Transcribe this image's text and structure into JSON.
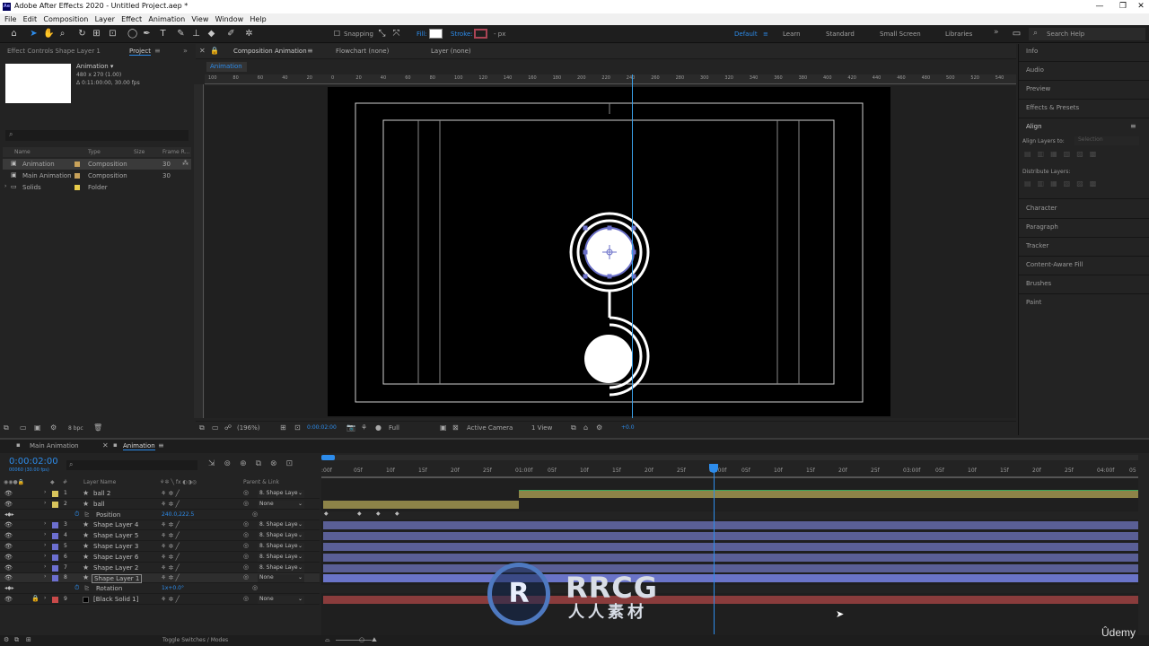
{
  "window": {
    "title": "Adobe After Effects 2020 - Untitled Project.aep *",
    "app_icon": "Ae",
    "buttons": [
      "minimize-icon",
      "restore-icon",
      "close-icon"
    ]
  },
  "menu": [
    "File",
    "Edit",
    "Composition",
    "Layer",
    "Effect",
    "Animation",
    "View",
    "Window",
    "Help"
  ],
  "toolbar": {
    "snapping_label": "Snapping",
    "fill_label": "Fill:",
    "stroke_label": "Stroke:",
    "stroke_units": "- px",
    "workspaces": [
      "Default",
      "Learn",
      "Standard",
      "Small Screen",
      "Libraries"
    ],
    "active_workspace": "Default",
    "search_placeholder": "Search Help"
  },
  "project_panel": {
    "tab_effect_controls": "Effect Controls Shape Layer 1",
    "tab_project": "Project",
    "comp_name": "Animation ▾",
    "comp_info1": "480 x 270 (1.00)",
    "comp_info2": "Δ 0:11:00:00, 30.00 fps",
    "columns": [
      "Name",
      "Type",
      "Size",
      "Frame R..."
    ],
    "items": [
      {
        "name": "Animation",
        "type": "Composition",
        "fps": "30",
        "color": "#c8a25a",
        "selected": true
      },
      {
        "name": "Main Animation",
        "type": "Composition",
        "fps": "30",
        "color": "#c8a25a",
        "selected": false
      },
      {
        "name": "Solids",
        "type": "Folder",
        "fps": "",
        "color": "#e8cc4a",
        "selected": false
      }
    ],
    "bpc": "8 bpc"
  },
  "comp_panel": {
    "tab_comp": "Composition Animation",
    "tab_flowchart": "Flowchart (none)",
    "tab_layer": "Layer (none)",
    "breadcrumb": "Animation",
    "ruler_ticks": [
      "100",
      "80",
      "60",
      "40",
      "20",
      "0",
      "20",
      "40",
      "60",
      "80",
      "100",
      "120",
      "140",
      "160",
      "180",
      "200",
      "220",
      "240",
      "260",
      "280",
      "300",
      "320",
      "340",
      "360",
      "380",
      "400",
      "420",
      "440",
      "460",
      "480",
      "500",
      "520",
      "540"
    ],
    "zoom": "(196%)",
    "timecode": "0:00:02:00",
    "resolution": "Full",
    "camera": "Active Camera",
    "views": "1 View",
    "exposure": "+0.0"
  },
  "right_panel": {
    "items": [
      "Info",
      "Audio",
      "Preview",
      "Effects & Presets",
      "Align",
      "Character",
      "Paragraph",
      "Tracker",
      "Content-Aware Fill",
      "Brushes",
      "Paint"
    ],
    "align_layers_to_label": "Align Layers to:",
    "align_layers_to_value": "Selection",
    "distribute_label": "Distribute Layers:"
  },
  "timeline": {
    "tabs": [
      "Main Animation",
      "Animation"
    ],
    "active_tab": "Animation",
    "timecode": "0:00:02:00",
    "timecode_sub": "00060 (30.00 fps)",
    "headers": [
      "#",
      "Layer Name",
      "Parent & Link"
    ],
    "time_ticks": [
      ":00f",
      "05f",
      "10f",
      "15f",
      "20f",
      "25f",
      "01:00f",
      "05f",
      "10f",
      "15f",
      "20f",
      "25f",
      "02:00f",
      "05f",
      "10f",
      "15f",
      "20f",
      "25f",
      "03:00f",
      "05f",
      "10f",
      "15f",
      "20f",
      "25f",
      "04:00f",
      "05"
    ],
    "layers": [
      {
        "num": "1",
        "name": "ball 2",
        "parent": "8. Shape Laye",
        "label": "#d8c45c",
        "type": "shape",
        "bar": "#8d8348"
      },
      {
        "num": "2",
        "name": "ball",
        "parent": "None",
        "label": "#d8c45c",
        "type": "shape",
        "bar": "#8d8348"
      },
      {
        "num": "",
        "name": "Position",
        "value": "240.0,222.5",
        "type": "prop"
      },
      {
        "num": "3",
        "name": "Shape Layer 4",
        "parent": "8. Shape Laye",
        "label": "#6c6fcf",
        "type": "shape",
        "bar": "#5a5f96"
      },
      {
        "num": "4",
        "name": "Shape Layer 5",
        "parent": "8. Shape Laye",
        "label": "#6c6fcf",
        "type": "shape",
        "bar": "#5a5f96"
      },
      {
        "num": "5",
        "name": "Shape Layer 3",
        "parent": "8. Shape Laye",
        "label": "#6c6fcf",
        "type": "shape",
        "bar": "#5a5f96"
      },
      {
        "num": "6",
        "name": "Shape Layer 6",
        "parent": "8. Shape Laye",
        "label": "#6c6fcf",
        "type": "shape",
        "bar": "#5a5f96"
      },
      {
        "num": "7",
        "name": "Shape Layer 2",
        "parent": "8. Shape Laye",
        "label": "#6c6fcf",
        "type": "shape",
        "bar": "#5a5f96"
      },
      {
        "num": "8",
        "name": "Shape Layer 1",
        "parent": "None",
        "label": "#6c6fcf",
        "type": "shape",
        "bar": "#6a74c8"
      },
      {
        "num": "",
        "name": "Rotation",
        "value": "1x+0.0°",
        "type": "prop"
      },
      {
        "num": "9",
        "name": "[Black Solid 1]",
        "parent": "None",
        "label": "#c94a4a",
        "type": "solid",
        "bar": "#8a3c3c"
      }
    ],
    "toggle_label": "Toggle Switches / Modes"
  },
  "watermark": {
    "logo": "R",
    "text": "RRCG",
    "cn": "人人素材"
  },
  "udemy": "Ûdemy",
  "colors": {
    "accent": "#2d8ceb",
    "panel": "#232323",
    "canvas": "#000000"
  }
}
